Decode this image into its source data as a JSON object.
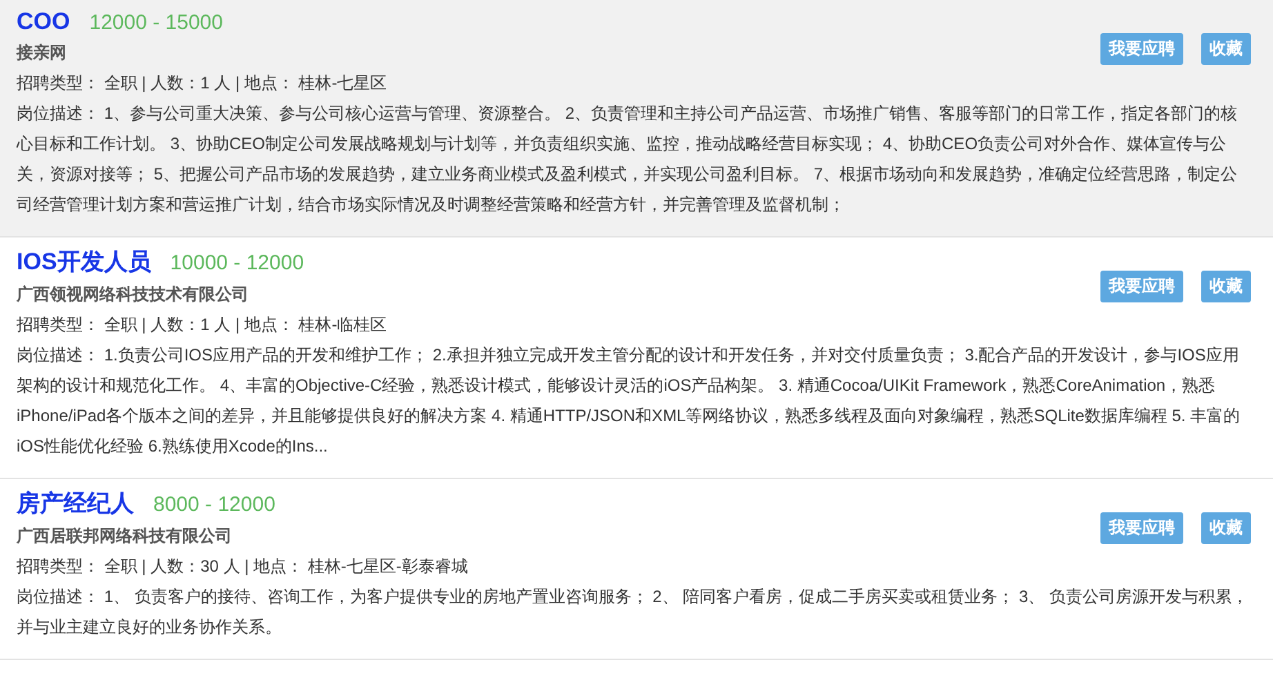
{
  "jobs": [
    {
      "title": "COO",
      "salary": "12000 - 15000",
      "company": "接亲网",
      "meta": "招聘类型： 全职 | 人数：1 人 | 地点： 桂林-七星区",
      "description": "岗位描述： 1、参与公司重大决策、参与公司核心运营与管理、资源整合。 2、负责管理和主持公司产品运营、市场推广销售、客服等部门的日常工作，指定各部门的核心目标和工作计划。 3、协助CEO制定公司发展战略规划与计划等，并负责组织实施、监控，推动战略经营目标实现； 4、协助CEO负责公司对外合作、媒体宣传与公关，资源对接等； 5、把握公司产品市场的发展趋势，建立业务商业模式及盈利模式，并实现公司盈利目标。 7、根据市场动向和发展趋势，准确定位经营思路，制定公司经营管理计划方案和营运推广计划，结合市场实际情况及时调整经营策略和经营方针，并完善管理及监督机制；",
      "highlighted": true,
      "buttons": [
        "我要应聘",
        "收藏"
      ]
    },
    {
      "title": "IOS开发人员",
      "salary": "10000 - 12000",
      "company": "广西领视网络科技技术有限公司",
      "meta": "招聘类型： 全职 | 人数：1 人 | 地点： 桂林-临桂区",
      "description": "岗位描述： 1.负责公司IOS应用产品的开发和维护工作； 2.承担并独立完成开发主管分配的设计和开发任务，并对交付质量负责； 3.配合产品的开发设计，参与IOS应用架构的设计和规范化工作。 4、丰富的Objective-C经验，熟悉设计模式，能够设计灵活的iOS产品构架。 3. 精通Cocoa/UIKit Framework，熟悉CoreAnimation，熟悉iPhone/iPad各个版本之间的差异，并且能够提供良好的解决方案 4. 精通HTTP/JSON和XML等网络协议，熟悉多线程及面向对象编程，熟悉SQLite数据库编程 5. 丰富的iOS性能优化经验 6.熟练使用Xcode的Ins...",
      "highlighted": false,
      "buttons": [
        "我要应聘",
        "收藏"
      ]
    },
    {
      "title": "房产经纪人",
      "salary": "8000 - 12000",
      "company": "广西居联邦网络科技有限公司",
      "meta": "招聘类型： 全职 | 人数：30 人 | 地点： 桂林-七星区-彰泰睿城",
      "description": "岗位描述： 1、 负责客户的接待、咨询工作，为客户提供专业的房地产置业咨询服务； 2、 陪同客户看房，促成二手房买卖或租赁业务； 3、 负责公司房源开发与积累，并与业主建立良好的业务协作关系。",
      "highlighted": false,
      "buttons": [
        "我要应聘",
        "收藏"
      ]
    }
  ]
}
